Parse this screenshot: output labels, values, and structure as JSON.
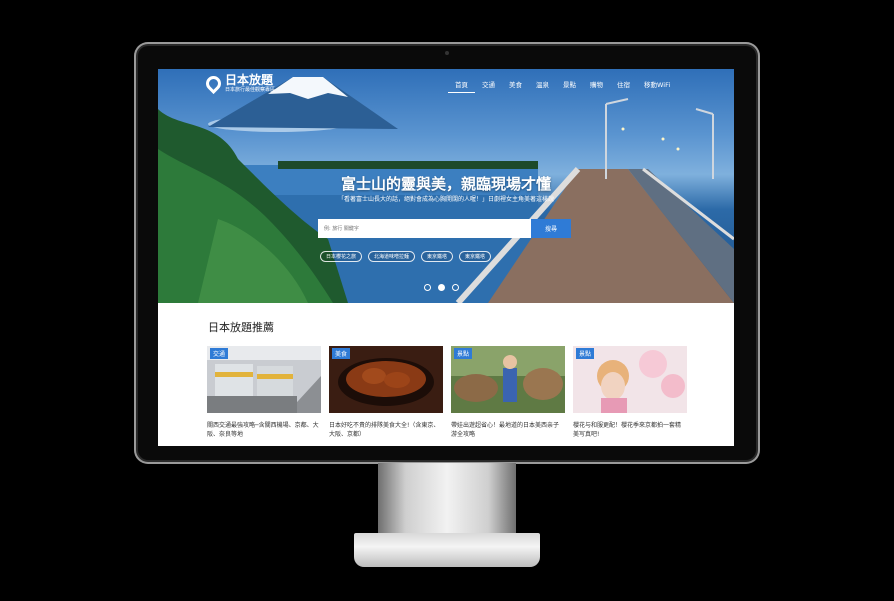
{
  "site": {
    "title": "日本放題",
    "subtitle": "日本旅行最佳觀察專區"
  },
  "nav": [
    {
      "label": "首頁",
      "active": true
    },
    {
      "label": "交通",
      "active": false
    },
    {
      "label": "美食",
      "active": false
    },
    {
      "label": "溫泉",
      "active": false
    },
    {
      "label": "景點",
      "active": false
    },
    {
      "label": "購物",
      "active": false
    },
    {
      "label": "住宿",
      "active": false
    },
    {
      "label": "移動WiFi",
      "active": false
    }
  ],
  "hero": {
    "title": "富士山的靈與美，親臨現場才懂",
    "subtitle": "「看著富士山長大的話，絕對會成為心胸開闊的人喔！」日劇裡女主角美著這樣說",
    "search_placeholder": "例: 旅行 關鍵字",
    "search_button": "搜尋",
    "tags": [
      "日本櫻花之旅",
      "北海道味噌拉麵",
      "東京鐵塔",
      "東京鐵塔"
    ]
  },
  "recommend": {
    "title": "日本放題推薦",
    "cards": [
      {
        "badge": "交通",
        "text": "關西交通最強攻略─含關西機場、京都、大阪、奈良等地"
      },
      {
        "badge": "美食",
        "text": "日本好吃不貴的排隊美食大全!（含東京、大阪、京都）"
      },
      {
        "badge": "景點",
        "text": "帶娃出遊超省心！最地道的日本美西亲子游全攻略"
      },
      {
        "badge": "景點",
        "text": "櫻花与和服更配！櫻花季來京都拍一套精美写真吧!"
      }
    ]
  }
}
